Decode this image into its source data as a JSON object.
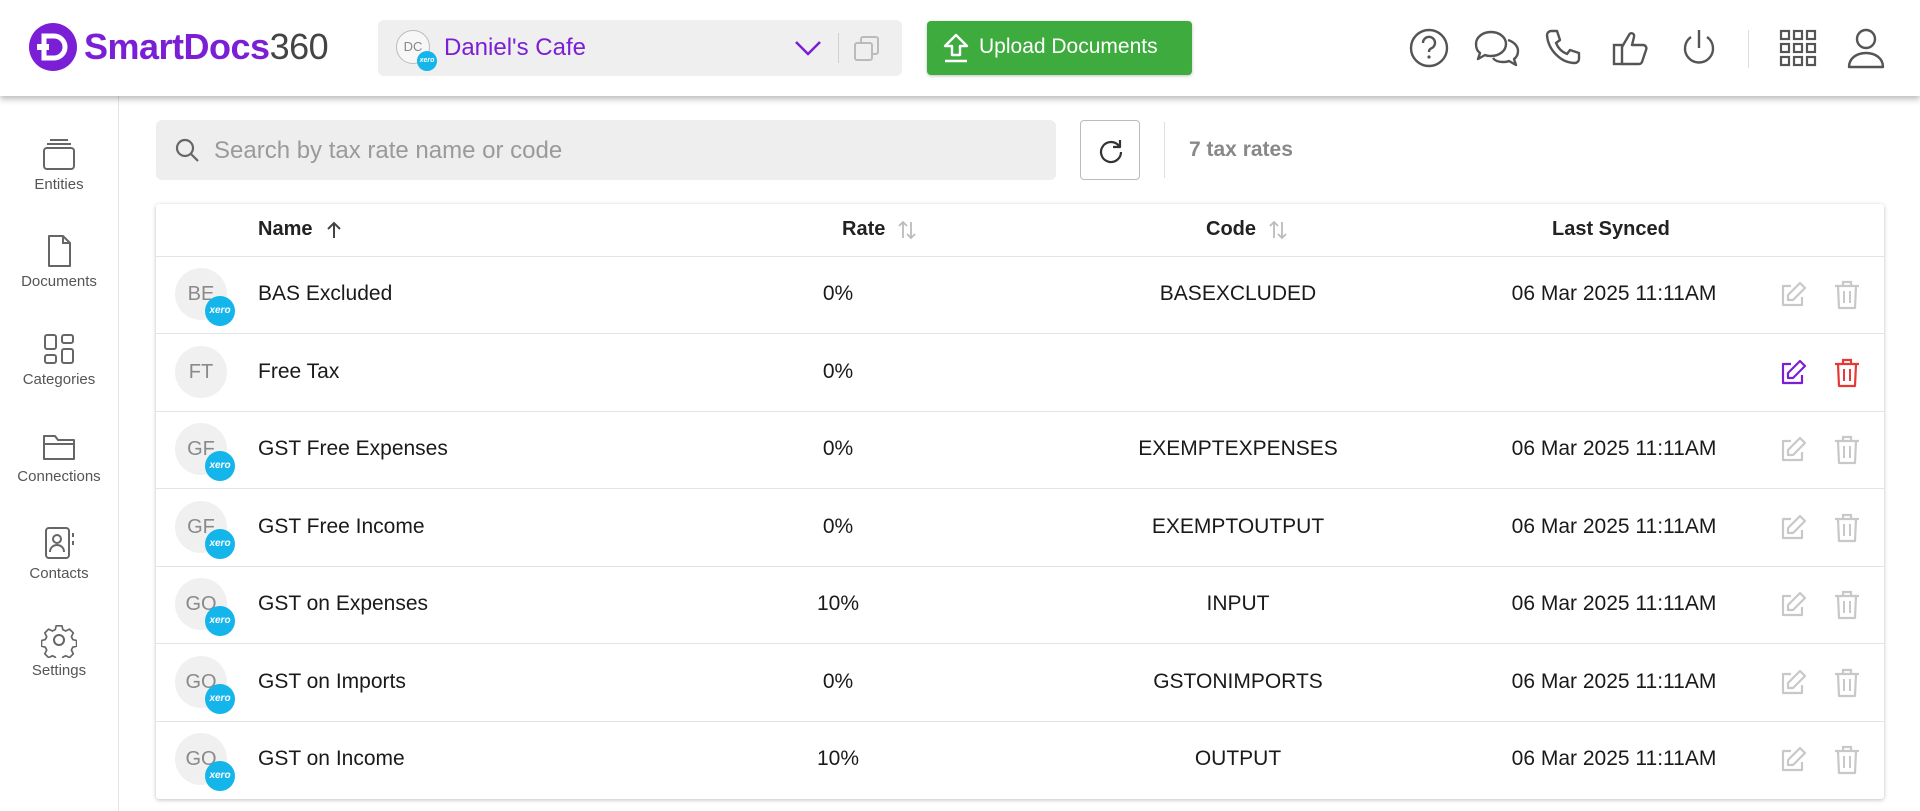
{
  "header": {
    "logo_smart": "SmartDocs",
    "logo_number": "360",
    "entity": {
      "initials": "DC",
      "badge": "xero",
      "name": "Daniel's Cafe"
    },
    "upload_label": "Upload Documents"
  },
  "sidebar": {
    "items": [
      {
        "label": "Entities",
        "icon": "stack-icon"
      },
      {
        "label": "Documents",
        "icon": "document-icon"
      },
      {
        "label": "Categories",
        "icon": "categories-icon"
      },
      {
        "label": "Connections",
        "icon": "folder-icon"
      },
      {
        "label": "Contacts",
        "icon": "contacts-icon"
      },
      {
        "label": "Settings",
        "icon": "gear-icon"
      }
    ]
  },
  "toolbar": {
    "search_placeholder": "Search by tax rate name or code",
    "search_value": "",
    "count_text": "7 tax rates"
  },
  "table": {
    "columns": {
      "name": "Name",
      "rate": "Rate",
      "code": "Code",
      "last_synced": "Last Synced"
    },
    "sort": {
      "column": "Name",
      "direction": "ascending"
    },
    "rows": [
      {
        "initials": "BE",
        "xero": true,
        "name": "BAS Excluded",
        "rate": "0%",
        "code": "BASEXCLUDED",
        "last_synced": "06 Mar 2025 11:11AM",
        "actions_enabled": false
      },
      {
        "initials": "FT",
        "xero": false,
        "name": "Free Tax",
        "rate": "0%",
        "code": "",
        "last_synced": "",
        "actions_enabled": true
      },
      {
        "initials": "GF",
        "xero": true,
        "name": "GST Free Expenses",
        "rate": "0%",
        "code": "EXEMPTEXPENSES",
        "last_synced": "06 Mar 2025 11:11AM",
        "actions_enabled": false
      },
      {
        "initials": "GF",
        "xero": true,
        "name": "GST Free Income",
        "rate": "0%",
        "code": "EXEMPTOUTPUT",
        "last_synced": "06 Mar 2025 11:11AM",
        "actions_enabled": false
      },
      {
        "initials": "GO",
        "xero": true,
        "name": "GST on Expenses",
        "rate": "10%",
        "code": "INPUT",
        "last_synced": "06 Mar 2025 11:11AM",
        "actions_enabled": false
      },
      {
        "initials": "GO",
        "xero": true,
        "name": "GST on Imports",
        "rate": "0%",
        "code": "GSTONIMPORTS",
        "last_synced": "06 Mar 2025 11:11AM",
        "actions_enabled": false
      },
      {
        "initials": "GO",
        "xero": true,
        "name": "GST on Income",
        "rate": "10%",
        "code": "OUTPUT",
        "last_synced": "06 Mar 2025 11:11AM",
        "actions_enabled": false
      }
    ]
  },
  "colors": {
    "brand_purple": "#7b1fd6",
    "upload_green": "#3dab3e",
    "xero_blue": "#13b5ea",
    "delete_red": "#e53935",
    "disabled_icon": "#c8c8c8"
  }
}
